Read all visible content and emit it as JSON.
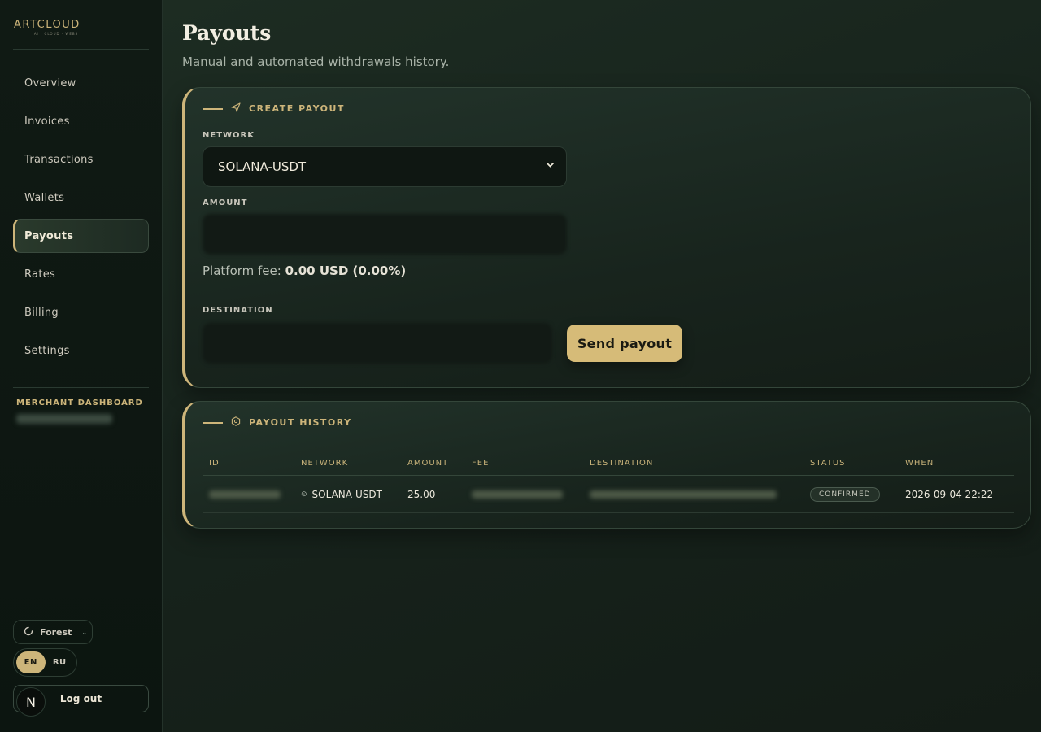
{
  "brand": {
    "logo": "ARTCLOUD",
    "logo_sub": "AI · CLOUD · WEB3"
  },
  "sidebar": {
    "items": [
      {
        "label": "Overview"
      },
      {
        "label": "Invoices"
      },
      {
        "label": "Transactions"
      },
      {
        "label": "Wallets"
      },
      {
        "label": "Payouts",
        "active": true
      },
      {
        "label": "Rates"
      },
      {
        "label": "Billing"
      },
      {
        "label": "Settings"
      }
    ],
    "merchant_label": "MERCHANT DASHBOARD",
    "theme": "Forest",
    "languages": [
      "EN",
      "RU"
    ],
    "active_language": "EN",
    "logout_label": "Log out",
    "badge": "N"
  },
  "page": {
    "title": "Payouts",
    "subtitle": "Manual and automated withdrawals history."
  },
  "create": {
    "heading": "CREATE PAYOUT",
    "network_label": "NETWORK",
    "network_value": "SOLANA-USDT",
    "amount_label": "AMOUNT",
    "fee_prefix": "Platform fee:",
    "fee_value": "0.00 USD (0.00%)",
    "destination_label": "DESTINATION",
    "send_label": "Send payout"
  },
  "history": {
    "heading": "PAYOUT HISTORY",
    "columns": [
      "ID",
      "NETWORK",
      "AMOUNT",
      "FEE",
      "DESTINATION",
      "STATUS",
      "WHEN"
    ],
    "rows": [
      {
        "network": "SOLANA-USDT",
        "amount": "25.00",
        "status": "CONFIRMED",
        "when": "2026-09-04 22:22"
      }
    ]
  },
  "colors": {
    "accent": "#cdb57a",
    "background": "#15211a"
  }
}
